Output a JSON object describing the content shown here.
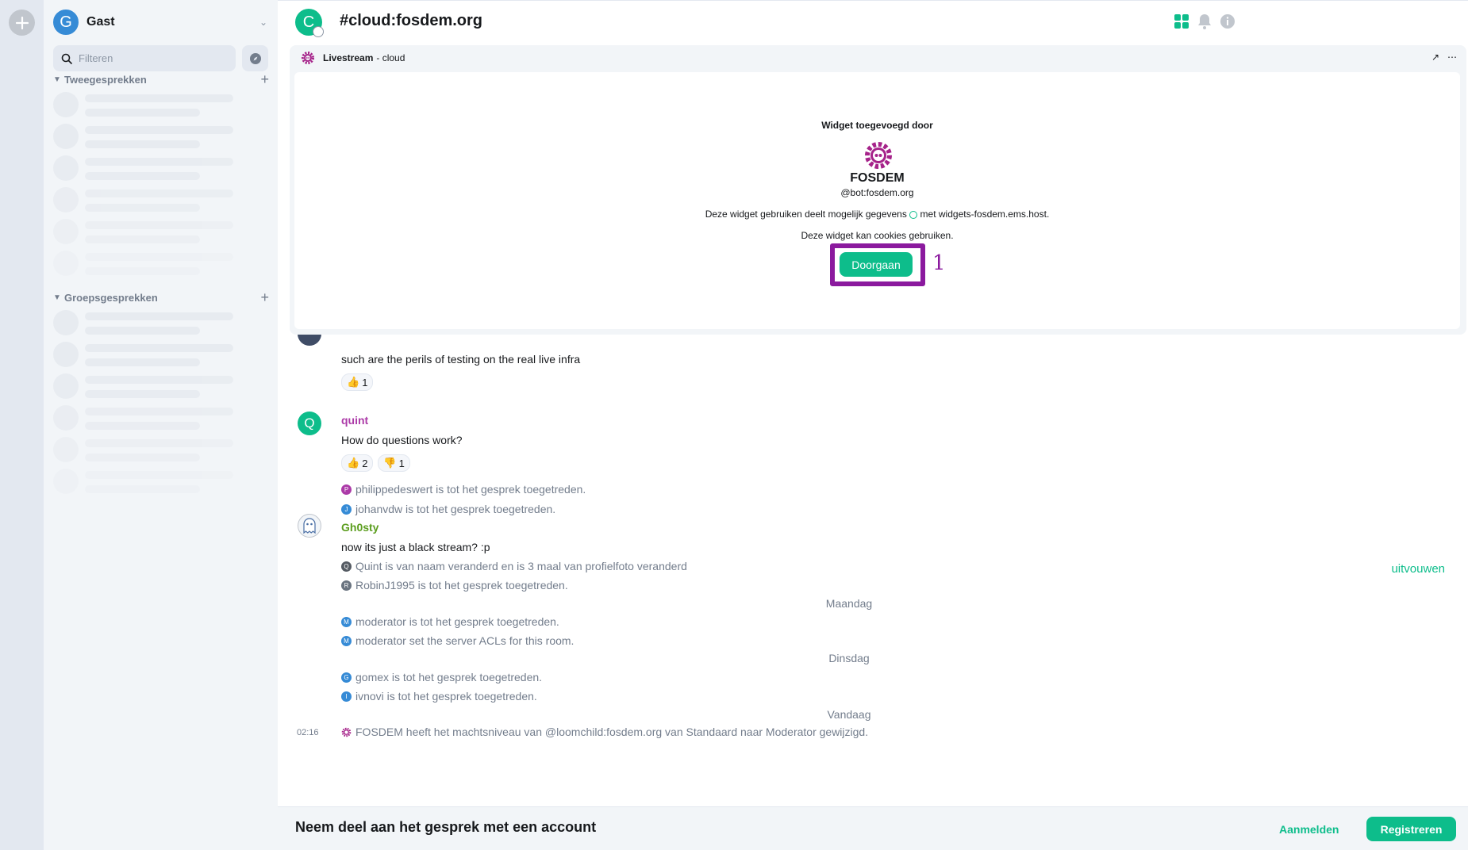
{
  "spaces": {
    "add_icon": "plus-icon"
  },
  "user": {
    "initial": "G",
    "name": "Gast"
  },
  "search": {
    "placeholder": "Filteren"
  },
  "sections": {
    "dms": {
      "label": "Tweegesprekken"
    },
    "rooms": {
      "label": "Groepsgesprekken"
    }
  },
  "room": {
    "initial": "C",
    "name": "#cloud:fosdem.org"
  },
  "widget": {
    "title": "Livestream",
    "subtitle": "- cloud",
    "added_by_label": "Widget toegevoegd door",
    "owner_name": "FOSDEM",
    "owner_id": "@bot:fosdem.org",
    "warning_data_pre": "Deze widget gebruiken deelt mogelijk gegevens",
    "warning_data_post": "met widgets-fosdem.ems.host.",
    "warning_cookies": "Deze widget kan cookies gebruiken.",
    "continue_label": "Doorgaan",
    "annotation_number": "1"
  },
  "timeline": {
    "msg1": {
      "body": "such are the perils of testing on the real live infra",
      "reactions": [
        {
          "emoji": "👍",
          "count": "1"
        }
      ]
    },
    "msg2": {
      "initial": "Q",
      "sender": "quint",
      "body": "How do questions work?",
      "reactions": [
        {
          "emoji": "👍",
          "count": "2"
        },
        {
          "emoji": "👎",
          "count": "1"
        }
      ]
    },
    "joins1": [
      {
        "initial": "P",
        "color": "#ac3ba8",
        "text": "philippedeswert is tot het gesprek toegetreden."
      },
      {
        "initial": "J",
        "color": "#368bd6",
        "text": "johanvdw is tot het gesprek toegetreden."
      }
    ],
    "msg3": {
      "sender": "Gh0sty",
      "body": "now its just a black stream? :p"
    },
    "summary": [
      {
        "initial": "Q",
        "color": "#555b63",
        "text": "Quint is van naam veranderd en is 3 maal van profielfoto veranderd"
      },
      {
        "initial": "R",
        "color": "#6a7480",
        "text": "RobinJ1995 is tot het gesprek toegetreden."
      }
    ],
    "expand_label": "uitvouwen",
    "date_monday": "Maandag",
    "monday_events": [
      {
        "initial": "M",
        "color": "#368bd6",
        "text": "moderator is tot het gesprek toegetreden."
      },
      {
        "initial": "M",
        "color": "#368bd6",
        "text": "moderator set the server ACLs for this room."
      }
    ],
    "date_tuesday": "Dinsdag",
    "tuesday_events": [
      {
        "initial": "G",
        "color": "#368bd6",
        "text": "gomex is tot het gesprek toegetreden."
      },
      {
        "initial": "I",
        "color": "#368bd6",
        "text": "ivnovi is tot het gesprek toegetreden."
      }
    ],
    "date_today": "Vandaag",
    "last_event": {
      "time": "02:16",
      "text": "FOSDEM heeft het machtsniveau van @loomchild:fosdem.org van Standaard naar Moderator gewijzigd."
    }
  },
  "composer": {
    "join_text": "Neem deel aan het gesprek met een account",
    "login_label": "Aanmelden",
    "register_label": "Registreren"
  },
  "colors": {
    "accent": "#0dbd8b",
    "highlight": "#8b1a9e",
    "quint": "#ac3ba8",
    "gh0sty": "#5c9e1f"
  }
}
